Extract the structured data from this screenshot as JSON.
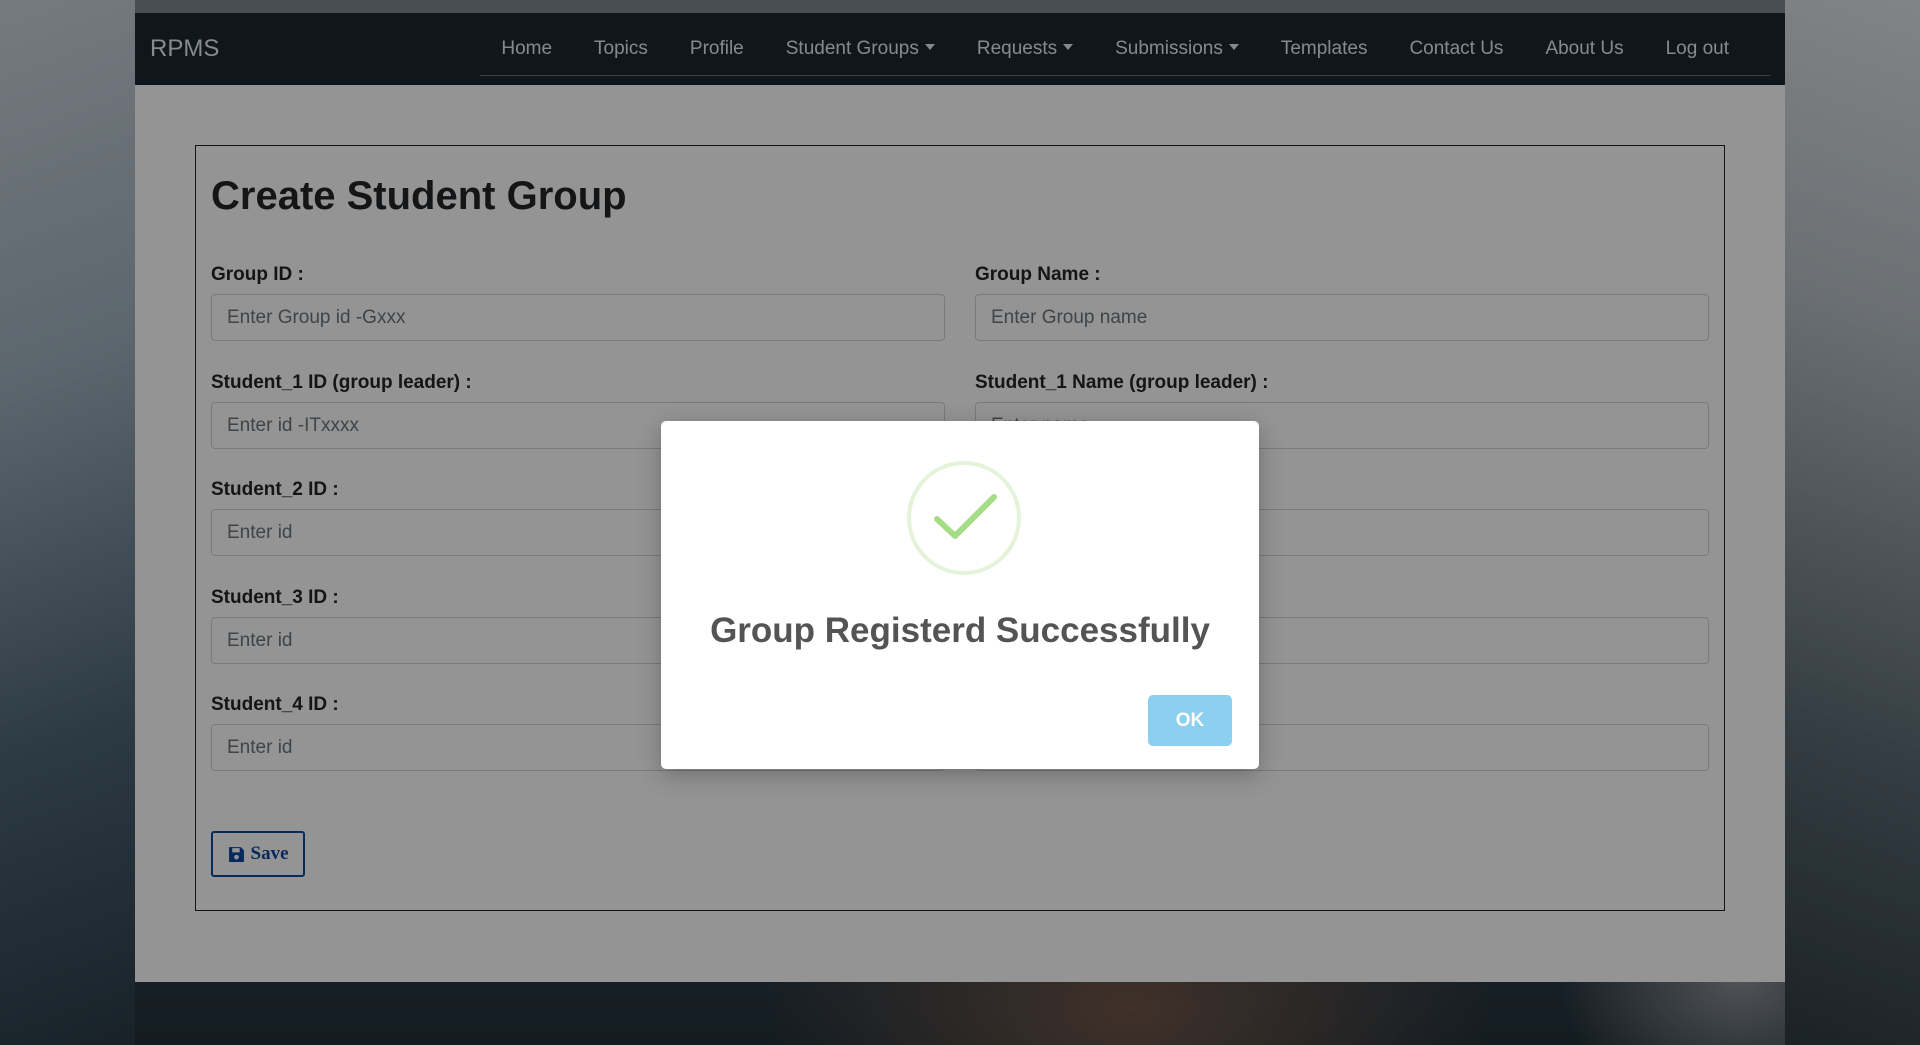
{
  "navbar": {
    "brand": "RPMS",
    "items": [
      {
        "label": "Home",
        "dropdown": false
      },
      {
        "label": "Topics",
        "dropdown": false
      },
      {
        "label": "Profile",
        "dropdown": false
      },
      {
        "label": "Student Groups",
        "dropdown": true
      },
      {
        "label": "Requests",
        "dropdown": true
      },
      {
        "label": "Submissions",
        "dropdown": true
      },
      {
        "label": "Templates",
        "dropdown": false
      },
      {
        "label": "Contact Us",
        "dropdown": false
      },
      {
        "label": "About Us",
        "dropdown": false
      },
      {
        "label": "Log out",
        "dropdown": false
      }
    ]
  },
  "form": {
    "title": "Create Student Group",
    "fields": {
      "group_id": {
        "label": "Group ID :",
        "placeholder": "Enter Group id -Gxxx",
        "value": ""
      },
      "group_name": {
        "label": "Group Name :",
        "placeholder": "Enter Group name",
        "value": ""
      },
      "student1_id": {
        "label": "Student_1 ID (group leader) :",
        "placeholder": "Enter id -ITxxxx",
        "value": ""
      },
      "student1_name": {
        "label": "Student_1 Name (group leader) :",
        "placeholder": "Enter name",
        "value": ""
      },
      "student2_id": {
        "label": "Student_2 ID :",
        "placeholder": "Enter id",
        "value": ""
      },
      "student2_name": {
        "label": "",
        "placeholder": "",
        "value": ""
      },
      "student3_id": {
        "label": "Student_3 ID :",
        "placeholder": "Enter id",
        "value": ""
      },
      "student3_name": {
        "label": "",
        "placeholder": "",
        "value": ""
      },
      "student4_id": {
        "label": "Student_4 ID :",
        "placeholder": "Enter id",
        "value": ""
      },
      "student4_name": {
        "label": "",
        "placeholder": "",
        "value": ""
      }
    },
    "save_label": "Save"
  },
  "modal": {
    "icon": "success-check-icon",
    "message": "Group Registerd Successfully",
    "ok_label": "OK"
  },
  "colors": {
    "navbar_bg": "#1b2631",
    "success_green": "#a5dc86",
    "ok_button": "#8ccfee",
    "save_button": "#0d47a1"
  }
}
